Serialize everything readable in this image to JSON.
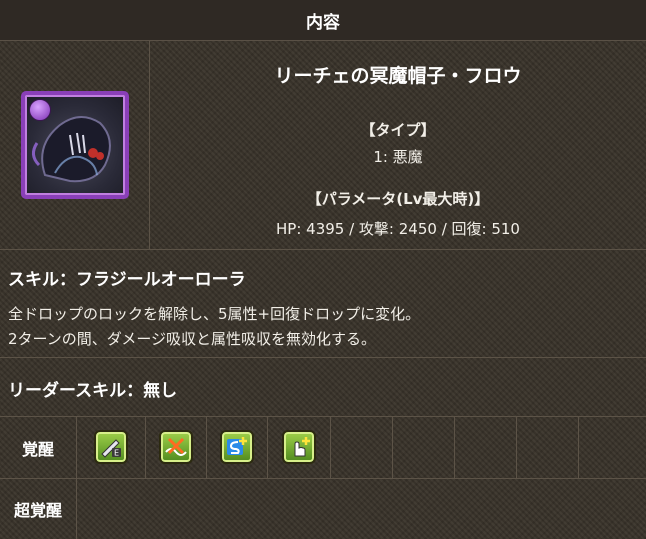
{
  "header": {
    "title": "内容"
  },
  "monster": {
    "name": "リーチェの冥魔帽子・フロウ",
    "type_label": "【タイプ】",
    "type_value": "1: 悪魔",
    "param_label": "【パラメータ(Lv最大時)】",
    "param_value": "HP: 4395 / 攻撃: 2450 / 回復: 510",
    "attribute_color": "#8a3fb8"
  },
  "skill": {
    "title": "スキル：フラジールオーローラ",
    "lines": [
      "全ドロップのロックを解除し、5属性+回復ドロップに変化。",
      "2ターンの間、ダメージ吸収と属性吸収を無効化する。"
    ]
  },
  "leader": {
    "title": "リーダースキル：無し"
  },
  "awakenings": {
    "label": "覚醒",
    "items": [
      {
        "icon": "enhanced-attack-icon"
      },
      {
        "icon": "damage-absorb-null-icon"
      },
      {
        "icon": "skill-boost-plus-icon"
      },
      {
        "icon": "extend-time-plus-icon"
      }
    ]
  },
  "super_awakenings": {
    "label": "超覚醒"
  }
}
